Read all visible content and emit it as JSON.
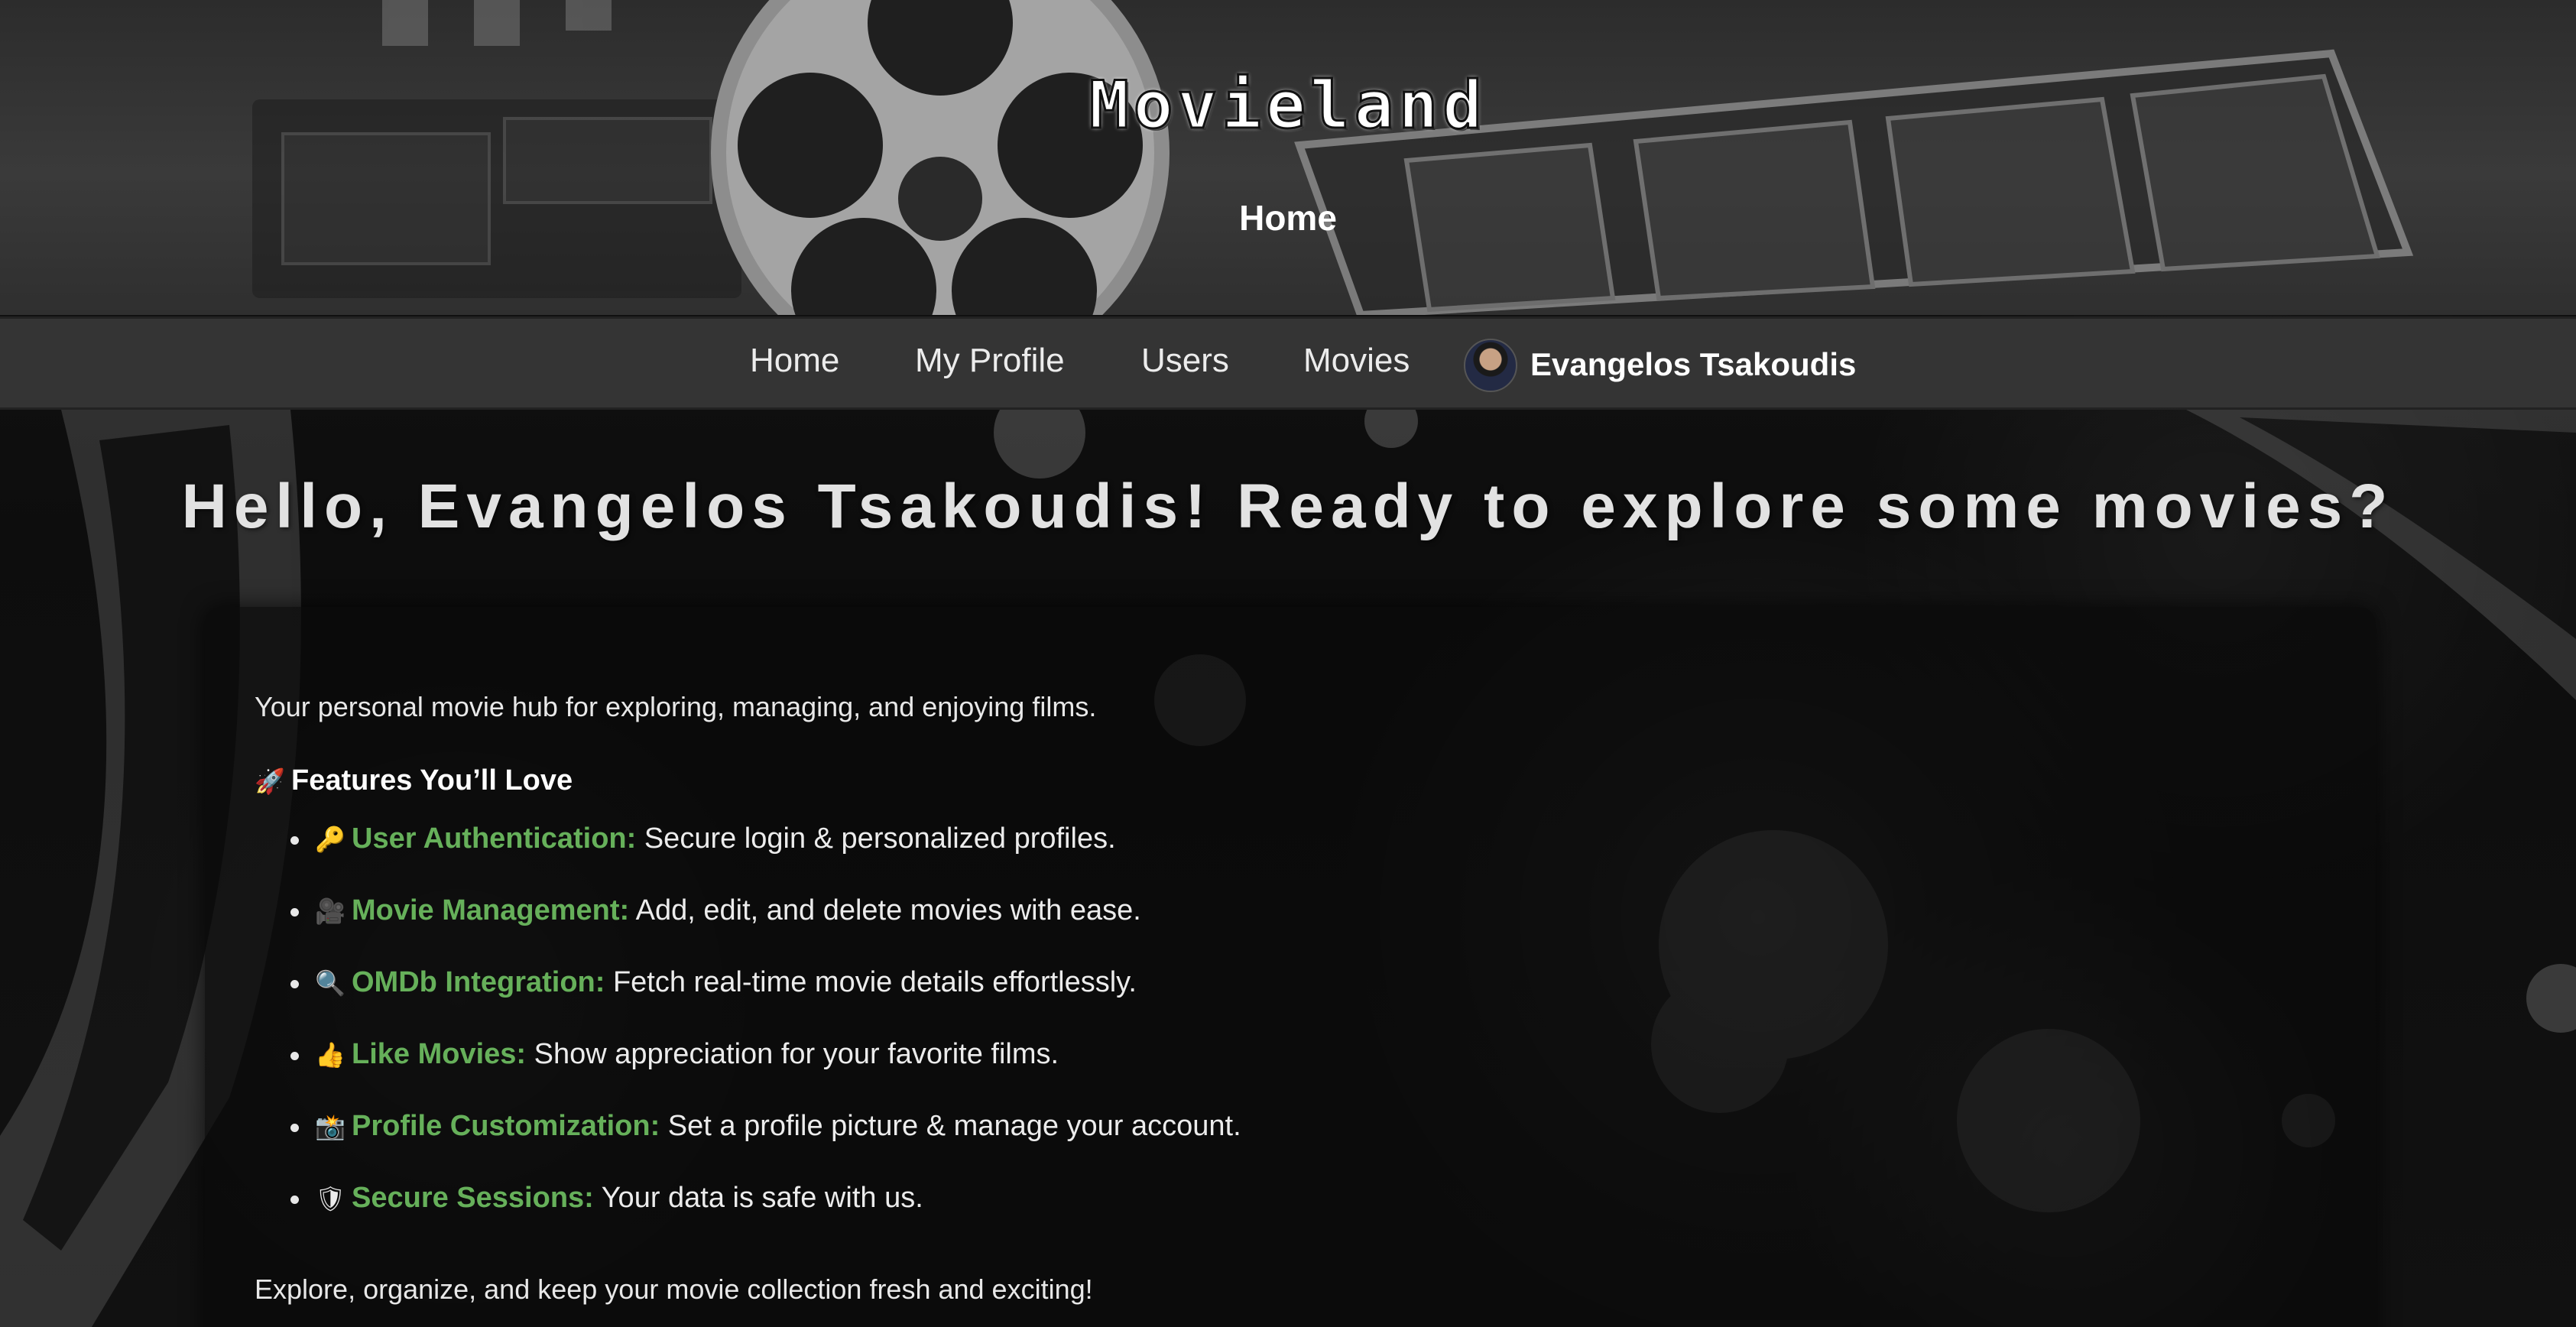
{
  "header": {
    "logo": "Movieland",
    "page_title": "Home"
  },
  "nav": {
    "links": [
      "Home",
      "My Profile",
      "Users",
      "Movies"
    ],
    "user_name": "Evangelos Tsakoudis"
  },
  "main": {
    "greeting": "Hello, Evangelos Tsakoudis! Ready to explore some movies?",
    "intro": "Your personal movie hub for exploring, managing, and enjoying films.",
    "features_heading": "Features You’ll Love",
    "features_heading_icon": "🚀",
    "features": [
      {
        "icon": "🔑",
        "icon_name": "key-icon",
        "title": "User Authentication:",
        "text": " Secure login & personalized profiles."
      },
      {
        "icon": "🎥",
        "icon_name": "movie-camera-icon",
        "title": "Movie Management:",
        "text": " Add, edit, and delete movies with ease."
      },
      {
        "icon": "🔍",
        "icon_name": "magnifier-icon",
        "title": "OMDb Integration:",
        "text": " Fetch real-time movie details effortlessly."
      },
      {
        "icon": "👍",
        "icon_name": "thumbs-up-icon",
        "title": "Like Movies:",
        "text": " Show appreciation for your favorite films."
      },
      {
        "icon": "📸",
        "icon_name": "camera-icon",
        "title": "Profile Customization:",
        "text": " Set a profile picture & manage your account."
      },
      {
        "icon": "🛡",
        "icon_name": "shield-icon",
        "title": "Secure Sessions:",
        "text": " Your data is safe with us."
      }
    ],
    "closing": "Explore, organize, and keep your movie collection fresh and exciting!"
  },
  "colors": {
    "accent_green": "#66b05a",
    "nav_background": "#343434"
  }
}
